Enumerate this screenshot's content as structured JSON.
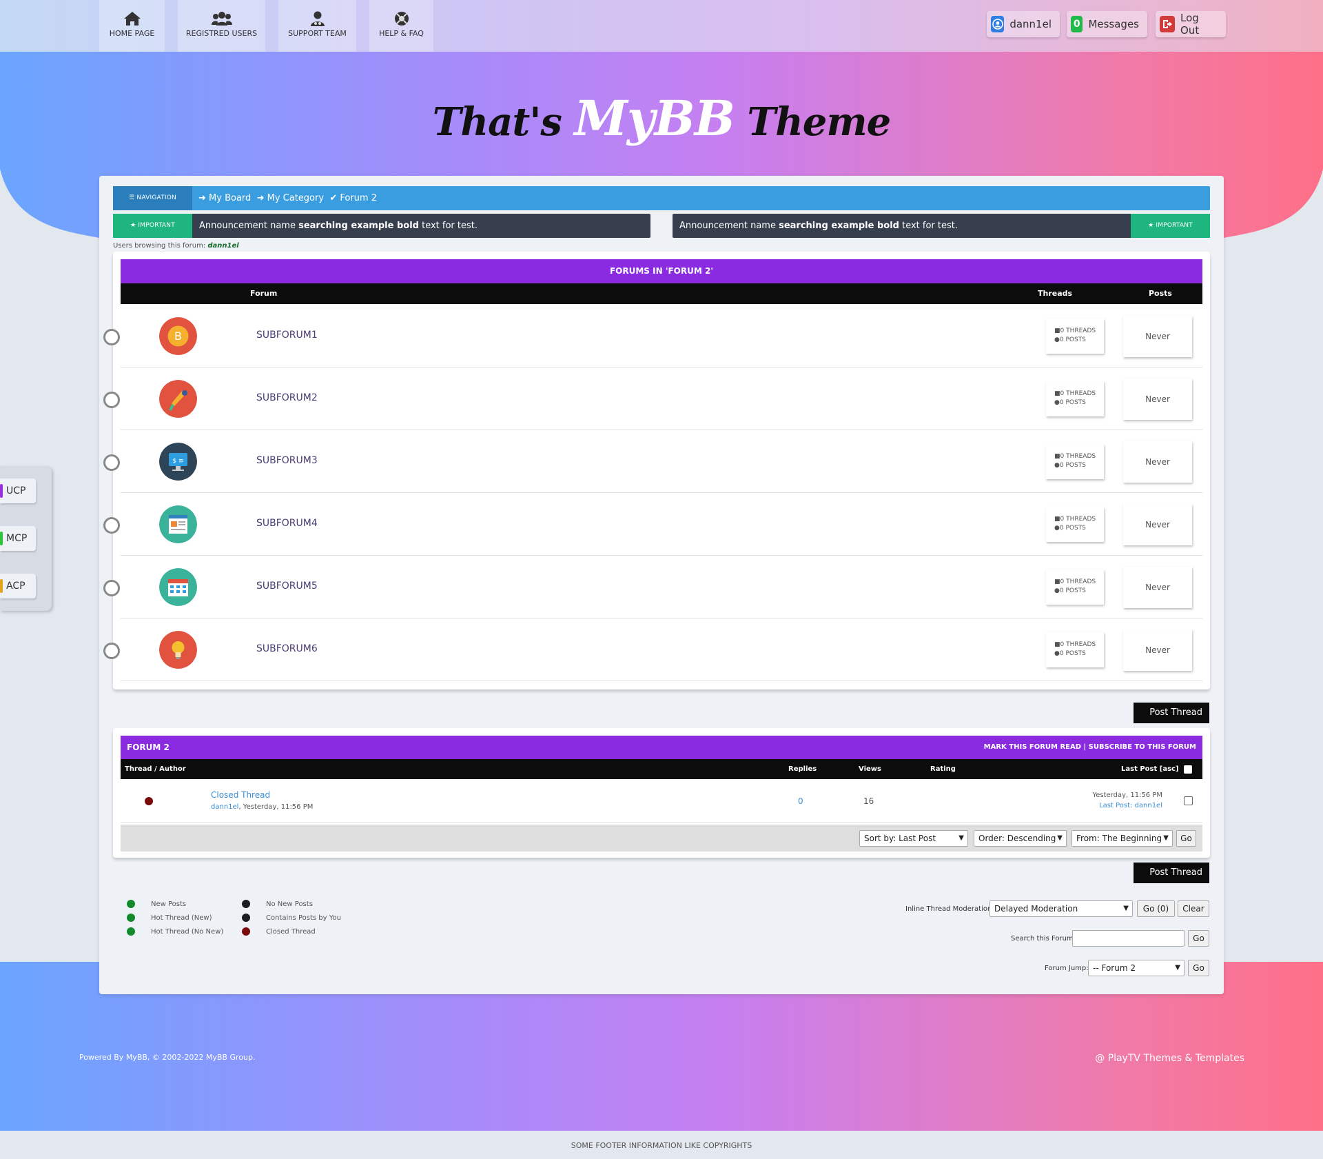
{
  "nav": {
    "tabs": [
      {
        "label": "HOME PAGE",
        "icon": "home-icon"
      },
      {
        "label": "REGISTRED USERS",
        "icon": "users-icon"
      },
      {
        "label": "SUPPORT TEAM",
        "icon": "support-icon"
      },
      {
        "label": "HELP & FAQ",
        "icon": "lifebuoy-icon"
      }
    ]
  },
  "user": {
    "name": "dann1el",
    "messages_count": "0",
    "messages_label": "Messages",
    "logout_label": "Log Out"
  },
  "logo": {
    "left": "That's",
    "middle": "MyBB",
    "right": "Theme"
  },
  "side": {
    "ucp": "UCP",
    "mcp": "MCP",
    "acp": "ACP"
  },
  "breadcrumb": {
    "tag": "NAVIGATION",
    "items": [
      "My Board",
      "My Category",
      "Forum 2"
    ]
  },
  "announcements": {
    "tag": "IMPORTANT",
    "prefix": "Announcement name ",
    "bold": "searching example bold",
    "suffix": " text for test."
  },
  "browsing": {
    "label": "Users browsing this forum: ",
    "user": "dann1el"
  },
  "subforums": {
    "title": "FORUMS IN 'FORUM 2'",
    "headers": {
      "forum": "Forum",
      "threads": "Threads",
      "posts": "Posts"
    },
    "threads_text": "0 THREADS",
    "posts_text": "0 POSTS",
    "last": "Never",
    "rows": [
      {
        "name": "SUBFORUM1",
        "icon": "bitcoin-icon"
      },
      {
        "name": "SUBFORUM2",
        "icon": "megaphone-icon"
      },
      {
        "name": "SUBFORUM3",
        "icon": "monitor-icon"
      },
      {
        "name": "SUBFORUM4",
        "icon": "newspaper-icon"
      },
      {
        "name": "SUBFORUM5",
        "icon": "calendar-icon"
      },
      {
        "name": "SUBFORUM6",
        "icon": "lightbulb-icon"
      }
    ]
  },
  "post_thread": "Post Thread",
  "forum": {
    "title": "FORUM 2",
    "actions": "MARK THIS FORUM READ | SUBSCRIBE TO THIS FORUM",
    "headers": {
      "thread": "Thread / Author",
      "replies": "Replies",
      "views": "Views",
      "rating": "Rating",
      "lastpost": "Last Post [asc]"
    },
    "thread": {
      "title": "Closed Thread",
      "author": "dann1el",
      "date": ", Yesterday, 11:56 PM",
      "replies": "0",
      "views": "16",
      "last_date": "Yesterday, 11:56 PM",
      "last_prefix": "Last Post: ",
      "last_user": "dann1el"
    },
    "sort": {
      "sort_by": "Sort by: Last Post",
      "order": "Order: Descending",
      "from": "From: The Beginning",
      "go": "Go"
    }
  },
  "legend": [
    {
      "label": "New Posts",
      "color": "#138a2e"
    },
    {
      "label": "Hot Thread (New)",
      "color": "#138a2e"
    },
    {
      "label": "Hot Thread (No New)",
      "color": "#138a2e"
    },
    {
      "label": "No New Posts",
      "color": "#1a1d24"
    },
    {
      "label": "Contains Posts by You",
      "color": "#1a1d24"
    },
    {
      "label": "Closed Thread",
      "color": "#7a0b0b"
    }
  ],
  "moderation": {
    "label": "Inline Thread Moderation:",
    "selected": "Delayed Moderation",
    "go": "Go (0)",
    "clear": "Clear"
  },
  "search": {
    "label": "Search this Forum:",
    "go": "Go"
  },
  "jump": {
    "label": "Forum Jump:",
    "selected": "-- Forum 2",
    "go": "Go"
  },
  "footer": {
    "powered": "Powered By MyBB, © 2002-2022 MyBB Group.",
    "credit": "@ PlayTV Themes & Templates",
    "bottom": "SOME FOOTER INFORMATION LIKE COPYRIGHTS"
  },
  "colors": {
    "accent_blue": "#3a9ddf",
    "purple": "#8a2be2",
    "green": "#1fb57f",
    "dark": "#373f4e"
  }
}
